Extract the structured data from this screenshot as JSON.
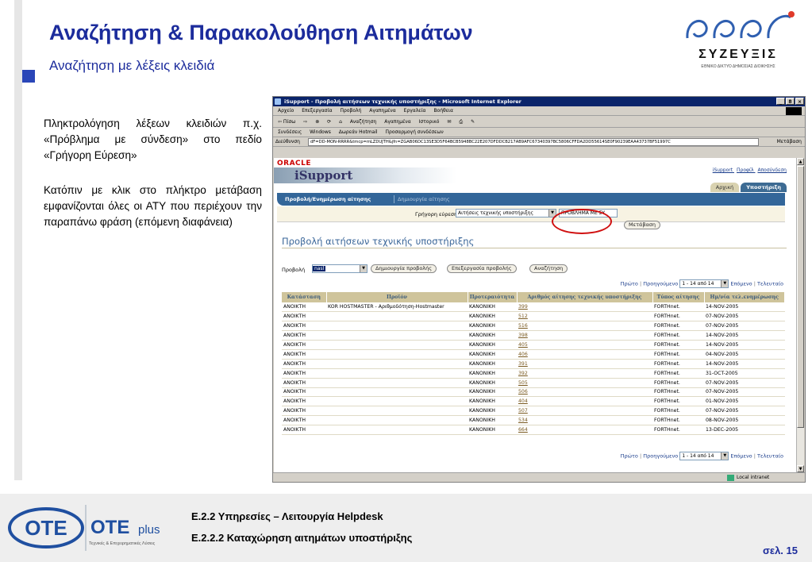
{
  "slide": {
    "title": "Αναζήτηση & Παρακολούθηση Αιτημάτων",
    "subtitle": "Αναζήτηση με λέξεις κλειδιά",
    "paragraph1": "Πληκτρολόγηση λέξεων κλειδιών π.χ. «Πρόβλημα με σύνδεση» στο πεδίο «Γρήγορη Εύρεση»",
    "paragraph2": "Κατόπιν με κλικ στο πλήκτρο μετάβαση εμφανίζονται όλες οι ΑΤΥ που περιέχουν την παραπάνω φράση (επόμενη διαφάνεια)",
    "footer_line1": "Ε.2.2 Υπηρεσίες – Λειτουργία Helpdesk",
    "footer_line2": "Ε.2.2.2 Καταχώρηση αιτημάτων υποστήριξης",
    "page_number": "σελ. 15"
  },
  "logos": {
    "corp_name": "ΣΥΖΕΥΞΙΣ",
    "corp_tagline": "ΕΘΝΙΚΟ ΔΙΚΤΥΟ ΔΗΜΟΣΙΑΣ ΔΙΟΙΚΗΣΗΣ",
    "ote_text": "OTE",
    "ote_plus": "OTE",
    "ote_plus_suffix": "plus",
    "ote_tagline": "Τεχνικές & Επιχειρηματικές Λύσεις"
  },
  "browser": {
    "window_title": "iSupport - Προβολή αιτήσεων τεχνικής υποστήριξης - Microsoft Internet Explorer",
    "window_buttons": [
      "_",
      "8",
      "×"
    ],
    "menu": [
      "Αρχείο",
      "Επεξεργασία",
      "Προβολή",
      "Αγαπημένα",
      "Εργαλεία",
      "Βοήθεια"
    ],
    "toolbar": [
      "⇦ Πίσω",
      "⇨",
      "⊗",
      "⟳",
      "⌂",
      "Αναζήτηση",
      "Αγαπημένα",
      "Ιστορικό",
      "✉",
      "⎙",
      "✎"
    ],
    "links_label": "Συνδέσεις",
    "links": [
      "Windows",
      "Δωρεάν Hotmail",
      "Προσαρμογή συνδέσεων"
    ],
    "address_label": "Διεύθυνση",
    "address_value": "dF=DD-MON-RRRR&tmcp=mLZDUJTH&jfn=ZGAB06DC13SE3D5F64BCB5948BC22E207DFDDCB217AB9AFC67340397BC5806CFFDA2DD55614SE0F90239EAA43737BF51997C",
    "address_go": "Μετάβαση",
    "status_zone": "Local intranet"
  },
  "app": {
    "oracle": "ORACLE",
    "brand": "iSupport",
    "global_links": [
      "iSupport",
      "Προφίλ",
      "Αποσύνδεση"
    ],
    "top_tabs": [
      "Αρχική",
      "Υποστήριξη"
    ],
    "subtabs": [
      "Προβολή/Ενημέρωση αίτησης",
      "Δημιουργία αίτησης"
    ],
    "quickfind_label": "Γρήγορη εύρεση",
    "quickfind_select": "Αιτήσεις τεχνικής υποστήριξης",
    "quickfind_value": "ΠΡΟΒΛΗΜΑ ΜΕ ΣΥ",
    "go_button": "Μετάβαση",
    "page_heading": "Προβολή αιτήσεων τεχνικής υποστήριξης",
    "view_label": "Προβολή",
    "view_select": "nasl",
    "buttons": [
      "Δημιουργία προβολής",
      "Επεξεργασία προβολής",
      "Αναζήτηση"
    ],
    "pager": {
      "first": "Πρώτο",
      "prev": "Προηγούμενο",
      "range": "1 - 14 από 14",
      "next": "Επόμενο",
      "last": "Τελευταίο"
    },
    "columns": [
      "Κατάσταση",
      "Προϊόν",
      "Προτεραιότητα",
      "Αριθμός αίτησης τεχνικής υποστήριξης",
      "Τύπος αίτησης",
      "Ημ/νία τελ.ενημέρωσης"
    ],
    "rows": [
      [
        "ΑΝΟΙΚΤΗ",
        "KOR HOSTMASTER - Αριθμοδότηση-Hostmaster",
        "ΚΑΝΟΝΙΚΗ",
        "399",
        "FORTHnet.",
        "14-NOV-2005"
      ],
      [
        "ΑΝΟΙΚΤΗ",
        "",
        "ΚΑΝΟΝΙΚΗ",
        "512",
        "FORTHnet.",
        "07-NOV-2005"
      ],
      [
        "ΑΝΟΙΚΤΗ",
        "",
        "ΚΑΝΟΝΙΚΗ",
        "516",
        "FORTHnet.",
        "07-NOV-2005"
      ],
      [
        "ΑΝΟΙΚΤΗ",
        "",
        "ΚΑΝΟΝΙΚΗ",
        "398",
        "FORTHnet.",
        "14-NOV-2005"
      ],
      [
        "ΑΝΟΙΚΤΗ",
        "",
        "ΚΑΝΟΝΙΚΗ",
        "405",
        "FORTHnet.",
        "14-NOV-2005"
      ],
      [
        "ΑΝΟΙΚΤΗ",
        "",
        "ΚΑΝΟΝΙΚΗ",
        "406",
        "FORTHnet.",
        "04-NOV-2005"
      ],
      [
        "ΑΝΟΙΚΤΗ",
        "",
        "ΚΑΝΟΝΙΚΗ",
        "391",
        "FORTHnet.",
        "14-NOV-2005"
      ],
      [
        "ΑΝΟΙΚΤΗ",
        "",
        "ΚΑΝΟΝΙΚΗ",
        "392",
        "FORTHnet.",
        "31-OCT-2005"
      ],
      [
        "ΑΝΟΙΚΤΗ",
        "",
        "ΚΑΝΟΝΙΚΗ",
        "505",
        "FORTHnet.",
        "07-NOV-2005"
      ],
      [
        "ΑΝΟΙΚΤΗ",
        "",
        "ΚΑΝΟΝΙΚΗ",
        "506",
        "FORTHnet.",
        "07-NOV-2005"
      ],
      [
        "ΑΝΟΙΚΤΗ",
        "",
        "ΚΑΝΟΝΙΚΗ",
        "404",
        "FORTHnet.",
        "01-NOV-2005"
      ],
      [
        "ΑΝΟΙΚΤΗ",
        "",
        "ΚΑΝΟΝΙΚΗ",
        "507",
        "FORTHnet.",
        "07-NOV-2005"
      ],
      [
        "ΑΝΟΙΚΤΗ",
        "",
        "ΚΑΝΟΝΙΚΗ",
        "534",
        "FORTHnet.",
        "08-NOV-2005"
      ],
      [
        "ΑΝΟΙΚΤΗ",
        "",
        "ΚΑΝΟΝΙΚΗ",
        "664",
        "FORTHnet.",
        "13-DEC-2005"
      ]
    ]
  },
  "colors": {
    "title_blue": "#1c2c9c",
    "tab_blue": "#336699",
    "table_header": "#cfc49b",
    "highlight_red": "#d01010"
  }
}
